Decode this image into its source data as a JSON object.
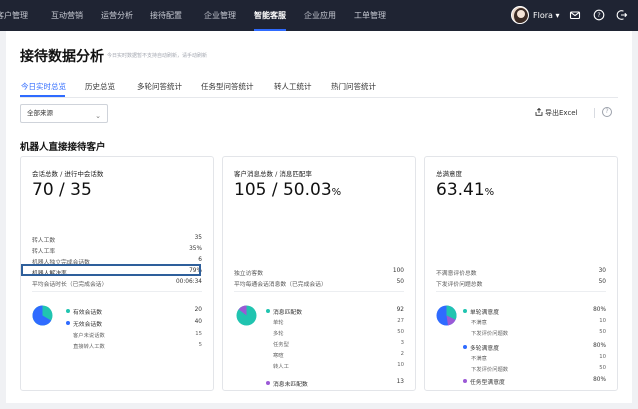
{
  "colors": {
    "nav_bg": "#1f2433",
    "accent": "#2f6bff",
    "pie_primary": "#2f6bff",
    "pie_secondary": "#20c4b0",
    "pie_tertiary": "#9b59d6",
    "highlight_box": "#2e5f9b"
  },
  "topnav": {
    "items": [
      {
        "label": "客户管理",
        "active": false
      },
      {
        "label": "互动营销",
        "active": false
      },
      {
        "label": "运营分析",
        "active": false
      },
      {
        "label": "接待配置",
        "active": false
      },
      {
        "label": "企业管理",
        "active": false
      },
      {
        "label": "智能客服",
        "active": true
      },
      {
        "label": "企业应用",
        "active": false
      },
      {
        "label": "工单管理",
        "active": false
      }
    ],
    "user_name": "Flora ▾",
    "icons": [
      "mail-icon",
      "help-icon",
      "logout-icon"
    ]
  },
  "page": {
    "title": "接待数据分析",
    "subtitle": "今日实时数据暂不支持自动刷新，请手动刷新"
  },
  "tabs": [
    {
      "label": "今日实时总览",
      "active": true
    },
    {
      "label": "历史总览",
      "active": false
    },
    {
      "label": "多轮问答统计",
      "active": false
    },
    {
      "label": "任务型问答统计",
      "active": false
    },
    {
      "label": "转人工统计",
      "active": false
    },
    {
      "label": "热门问答统计",
      "active": false
    }
  ],
  "filters": {
    "source_select": "全部来源",
    "export_label": "导出Excel",
    "help_glyph": "?"
  },
  "section_title": "机器人直接接待客户",
  "cards": [
    {
      "title": "会话总数 / 进行中会话数",
      "big_main": "70 / 35",
      "big_suffix": "",
      "rows": [
        {
          "label": "转人工数",
          "value": "35"
        },
        {
          "label": "转人工率",
          "value": "35%"
        },
        {
          "label": "机器人独立完成会话数",
          "value": "6"
        },
        {
          "label": "机器人解决率",
          "value": "79%"
        },
        {
          "label": "平均会话时长（已完成会话）",
          "value": "00:06:34"
        }
      ],
      "legend": [
        {
          "label": "有效会话数",
          "value": "20"
        },
        {
          "label": "无效会话数",
          "value": "40"
        }
      ],
      "legend_sub": [
        {
          "label": "客户未说话数",
          "value": "15"
        },
        {
          "label": "直接转人工数",
          "value": "5"
        }
      ]
    },
    {
      "title": "客户消息总数 / 消息匹配率",
      "big_main": "105 / 50.03",
      "big_suffix": "%",
      "rows": [
        {
          "label": "独立访客数",
          "value": "100"
        },
        {
          "label": "平均每通会话消息数（已完成会话）",
          "value": "50"
        }
      ],
      "legend": [
        {
          "label": "消息匹配数",
          "value": "92"
        },
        {
          "label": "消息未匹配数",
          "value": "13"
        }
      ],
      "legend_sub": [
        {
          "label": "单轮",
          "value": "27"
        },
        {
          "label": "多轮",
          "value": "50"
        },
        {
          "label": "任务型",
          "value": "3"
        },
        {
          "label": "寒暄",
          "value": "2"
        },
        {
          "label": "转人工",
          "value": "10"
        }
      ],
      "legend_sub2": [
        {
          "label": "未知问题",
          "value": "8"
        },
        {
          "label": "其他",
          "value": "5"
        }
      ]
    },
    {
      "title": "总满意度",
      "big_main": "63.41",
      "big_suffix": "%",
      "rows": [
        {
          "label": "不满意评价总数",
          "value": "30"
        },
        {
          "label": "下发评价问题总数",
          "value": "50"
        }
      ],
      "groups": [
        {
          "label": "单轮满意度",
          "value": "80%",
          "sub": [
            {
              "label": "不满意",
              "value": "10"
            },
            {
              "label": "下发评价问题数",
              "value": "50"
            }
          ]
        },
        {
          "label": "多轮满意度",
          "value": "80%",
          "sub": [
            {
              "label": "不满意",
              "value": "10"
            },
            {
              "label": "下发评价问题数",
              "value": "50"
            }
          ]
        },
        {
          "label": "任务型满意度",
          "value": "80%",
          "sub": [
            {
              "label": "不满意",
              "value": "10"
            },
            {
              "label": "下发评价问题数",
              "value": "50"
            }
          ]
        }
      ]
    }
  ]
}
